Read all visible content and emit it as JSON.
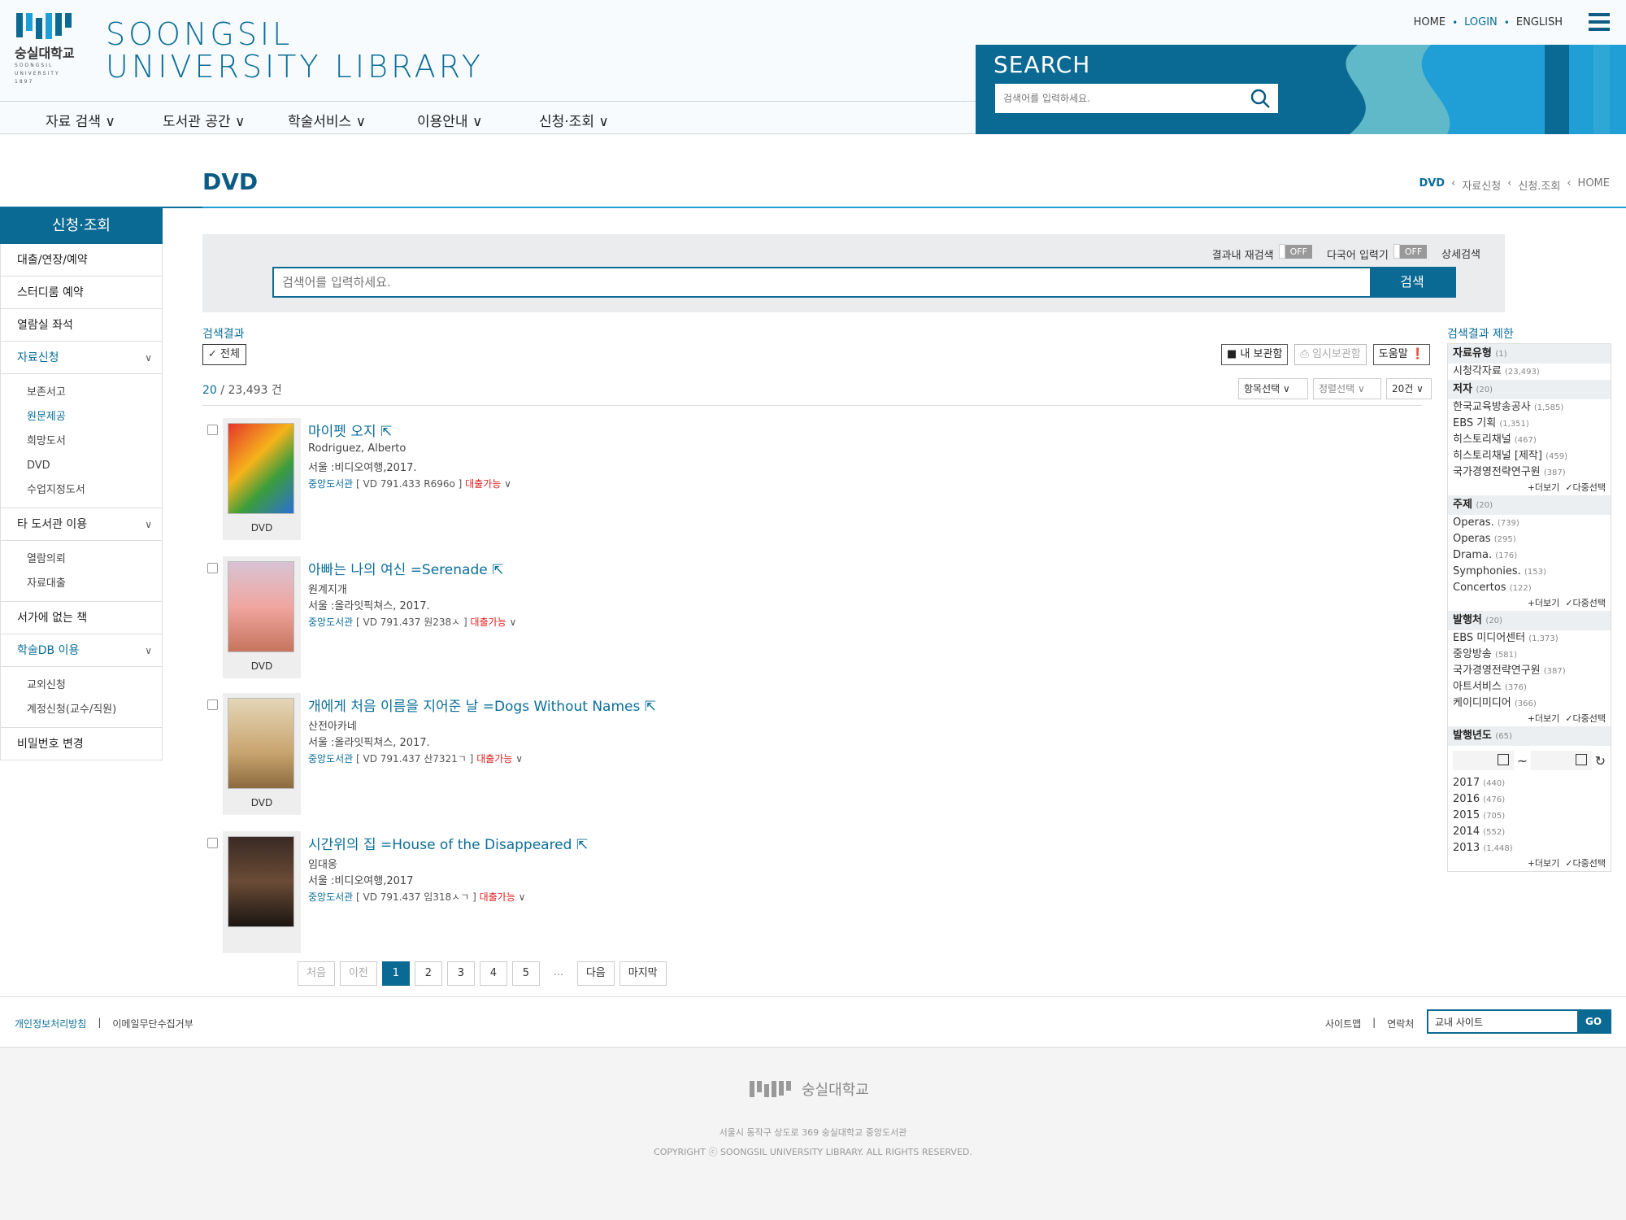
{
  "header": {
    "logo_korean": "숭실대학교",
    "logo_small": "SOONGSIL UNIVERSITY 1897",
    "title_line1": "SOONGSIL",
    "title_line2": "UNIVERSITY LIBRARY",
    "util_links": [
      "HOME",
      "LOGIN",
      "ENGLISH"
    ],
    "search_label": "SEARCH",
    "search_placeholder": "검색어를 입력하세요."
  },
  "gnb": [
    "자료 검색",
    "도서관 공간",
    "학술서비스",
    "이용안내",
    "신청·조회"
  ],
  "page": {
    "title": "DVD",
    "breadcrumb": [
      "DVD",
      "자료신청",
      "신청.조회",
      "HOME"
    ]
  },
  "sidebar": {
    "head": "신청·조회",
    "items": [
      {
        "label": "대출/연장/예약",
        "expandable": false
      },
      {
        "label": "스터디룸 예약",
        "expandable": false
      },
      {
        "label": "열람실 좌석",
        "expandable": false
      },
      {
        "label": "자료신청",
        "expandable": true,
        "subs": [
          "보존서고",
          "원문제공",
          "희망도서",
          "DVD",
          "수업지정도서"
        ],
        "active_sub": 1
      },
      {
        "label": "타 도서관 이용",
        "expandable": true,
        "subs": [
          "열람의뢰",
          "자료대출"
        ]
      },
      {
        "label": "서가에 없는 책",
        "expandable": false
      },
      {
        "label": "학술DB 이용",
        "expandable": true,
        "subs": [
          "교외신청",
          "계정신청(교수/직원)"
        ]
      },
      {
        "label": "비밀번호 변경",
        "expandable": false
      }
    ]
  },
  "main_search": {
    "opt_research": "결과내 재검색",
    "opt_multilang": "다국어 입력기",
    "toggle_off": "OFF",
    "opt_advanced": "상세검색",
    "placeholder": "검색어를 입력하세요.",
    "button": "검색"
  },
  "results": {
    "label": "검색결과",
    "all_chip": "전체",
    "tools": [
      "내 보관함",
      "임시보관함",
      "도움말"
    ],
    "count_shown": "20",
    "count_total": "/ 23,493 건",
    "sorts": [
      "항목선택",
      "정렬선택",
      "20건"
    ],
    "items": [
      {
        "title": "마이펫 오지",
        "author": "Rodriguez, Alberto",
        "pub": "서울 :비디오여행,2017.",
        "lib": "중앙도서관",
        "call": "[ VD 791.433 R696o ]",
        "status": "대출가능",
        "type": "DVD"
      },
      {
        "title": "아빠는 나의 여신 =Serenade",
        "author": "원계지개",
        "pub": "서울 :올라잇픽쳐스, 2017.",
        "lib": "중앙도서관",
        "call": "[ VD 791.437 원238ㅅ ]",
        "status": "대출가능",
        "type": "DVD"
      },
      {
        "title": "개에게 처음 이름을 지어준 날 =Dogs Without Names",
        "author": "산전아카네",
        "pub": "서울 :올라잇픽쳐스, 2017.",
        "lib": "중앙도서관",
        "call": "[ VD 791.437 산7321ㄱ ]",
        "status": "대출가능",
        "type": "DVD"
      },
      {
        "title": "시간위의 집 =House of the Disappeared",
        "author": "임대웅",
        "pub": "서울 :비디오여행,2017",
        "lib": "중앙도서관",
        "call": "[ VD 791.437 임318ㅅㄱ ]",
        "status": "대출가능",
        "type": ""
      }
    ]
  },
  "facets": {
    "title": "검색결과 제한",
    "more": "더보기",
    "multi": "다중선택",
    "groups": [
      {
        "name": "자료유형",
        "count": "(1)",
        "values": [
          [
            "시청각자료",
            "(23,493)"
          ]
        ],
        "show_more": false
      },
      {
        "name": "저자",
        "count": "(20)",
        "values": [
          [
            "한국교육방송공사",
            "(1,585)"
          ],
          [
            "EBS 기획",
            "(1,351)"
          ],
          [
            "히스토리채널",
            "(467)"
          ],
          [
            "히스토리채널 [제작]",
            "(459)"
          ],
          [
            "국가경영전략연구원",
            "(387)"
          ]
        ],
        "show_more": true
      },
      {
        "name": "주제",
        "count": "(20)",
        "values": [
          [
            "Operas.",
            "(739)"
          ],
          [
            "Operas",
            "(295)"
          ],
          [
            "Drama.",
            "(176)"
          ],
          [
            "Symphonies.",
            "(153)"
          ],
          [
            "Concertos",
            "(122)"
          ]
        ],
        "show_more": true
      },
      {
        "name": "발행처",
        "count": "(20)",
        "values": [
          [
            "EBS 미디어센터",
            "(1,373)"
          ],
          [
            "중앙방송",
            "(581)"
          ],
          [
            "국가경영전략연구원",
            "(387)"
          ],
          [
            "아트서비스",
            "(376)"
          ],
          [
            "케이디미디어",
            "(366)"
          ]
        ],
        "show_more": true
      },
      {
        "name": "발행년도",
        "count": "(65)",
        "values": [
          [
            "2017",
            "(440)"
          ],
          [
            "2016",
            "(476)"
          ],
          [
            "2015",
            "(705)"
          ],
          [
            "2014",
            "(552)"
          ],
          [
            "2013",
            "(1,448)"
          ]
        ],
        "show_more": true,
        "year_range": true
      }
    ]
  },
  "pager": {
    "first": "처음",
    "prev": "이전",
    "pages": [
      "1",
      "2",
      "3",
      "4",
      "5"
    ],
    "current": "1",
    "dots": "...",
    "next": "다음",
    "last": "마지막"
  },
  "footer": {
    "privacy": "개인정보처리방침",
    "email_refuse": "이메일무단수집거부",
    "sitemap": "사이트맵",
    "contact": "연락처",
    "site_search": "교내 사이트",
    "go": "GO",
    "bottom_logo": "숭실대학교",
    "address": "서울시 동작구 상도로 369 숭실대학교 중앙도서관",
    "copyright": "COPYRIGHT ⓒ SOONGSIL UNIVERSITY LIBRARY. ALL RIGHTS RESERVED."
  },
  "colors": {
    "primary": "#0b6a93",
    "accent_blue": "#1f9fd6",
    "available_red": "#e02020"
  }
}
